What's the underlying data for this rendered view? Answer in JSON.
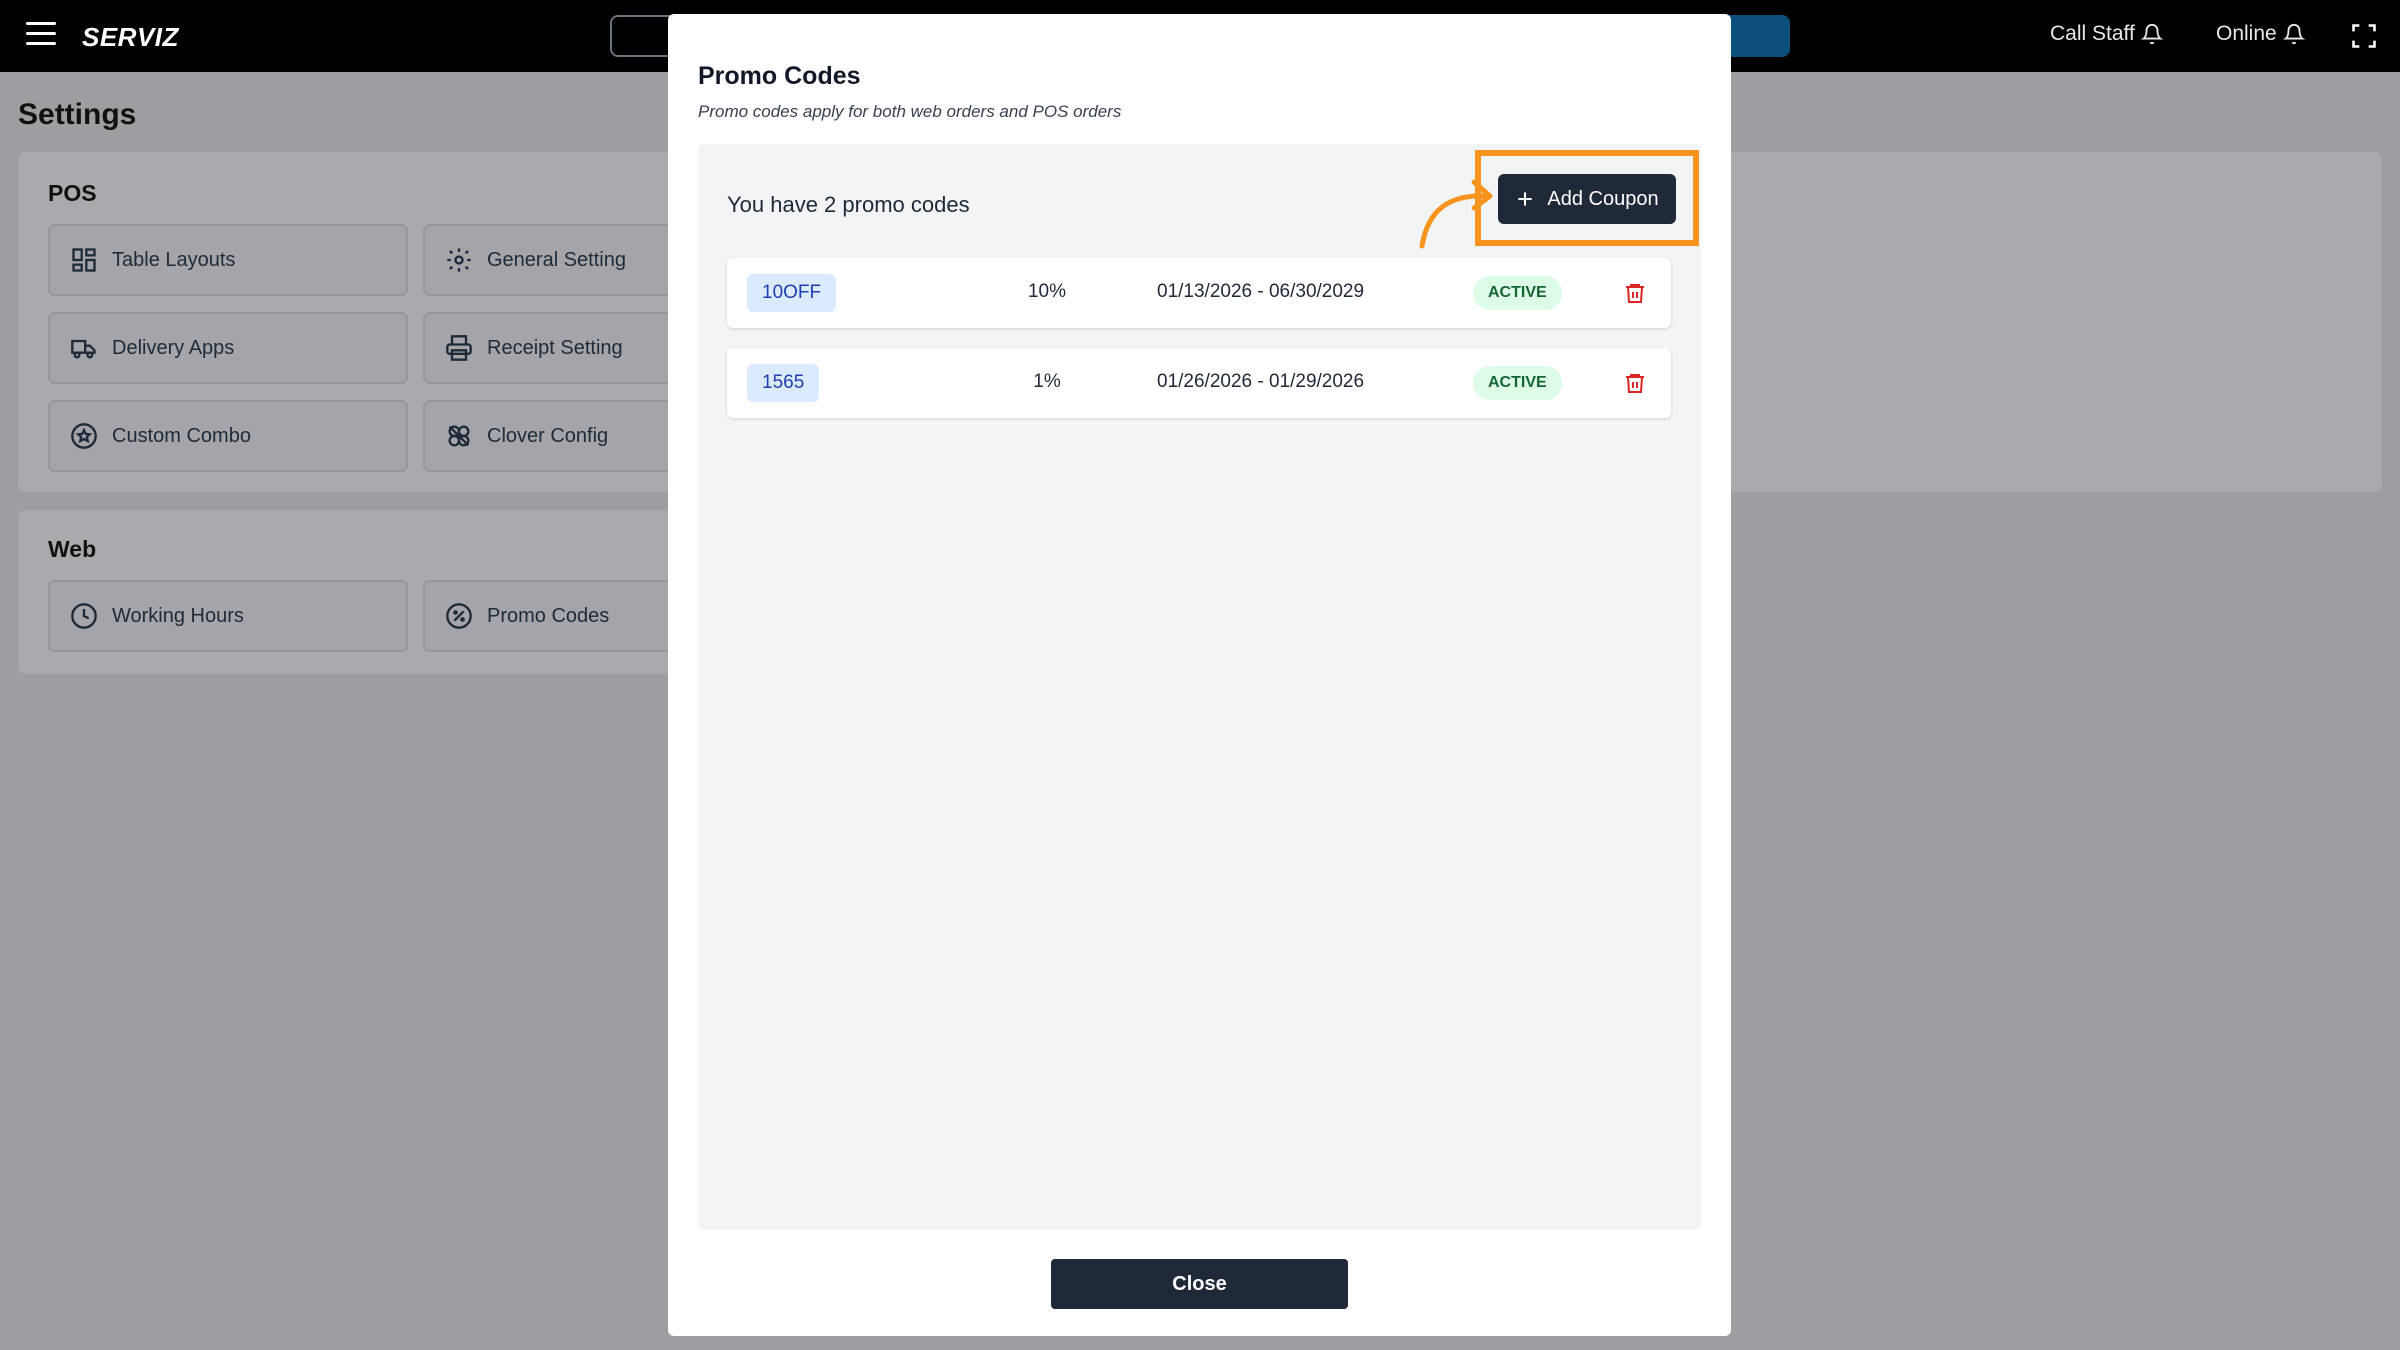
{
  "topbar": {
    "brand": "SERVIZ",
    "call_staff": "Call Staff",
    "online": "Online",
    "icons": [
      "menu-icon",
      "bell-icon",
      "fullscreen-icon"
    ]
  },
  "settings": {
    "title": "Settings",
    "pos": {
      "title": "POS",
      "items": [
        {
          "label": "Table Layouts",
          "icon": "layout-grid-icon"
        },
        {
          "label": "General Setting",
          "icon": "gear-icon"
        },
        {
          "label": "Delivery Apps",
          "icon": "truck-icon"
        },
        {
          "label": "Receipt Setting",
          "icon": "printer-icon"
        },
        {
          "label": "Custom Combo",
          "icon": "star-badge-icon"
        },
        {
          "label": "Clover Config",
          "icon": "clover-icon"
        }
      ]
    },
    "web": {
      "title": "Web",
      "items": [
        {
          "label": "Working Hours",
          "icon": "clock-icon"
        },
        {
          "label": "Promo Codes",
          "icon": "percent-badge-icon"
        }
      ]
    }
  },
  "modal": {
    "title": "Promo Codes",
    "subtitle": "Promo codes apply for both web orders and POS orders",
    "count_text": "You have 2 promo codes",
    "add_button": "Add Coupon",
    "close_button": "Close",
    "highlight_color": "#f7941d",
    "coupons": [
      {
        "code": "10OFF",
        "discount": "10%",
        "dates": "01/13/2026 - 06/30/2029",
        "status": "ACTIVE"
      },
      {
        "code": "1565",
        "discount": "1%",
        "dates": "01/26/2026 - 01/29/2026",
        "status": "ACTIVE"
      }
    ]
  }
}
